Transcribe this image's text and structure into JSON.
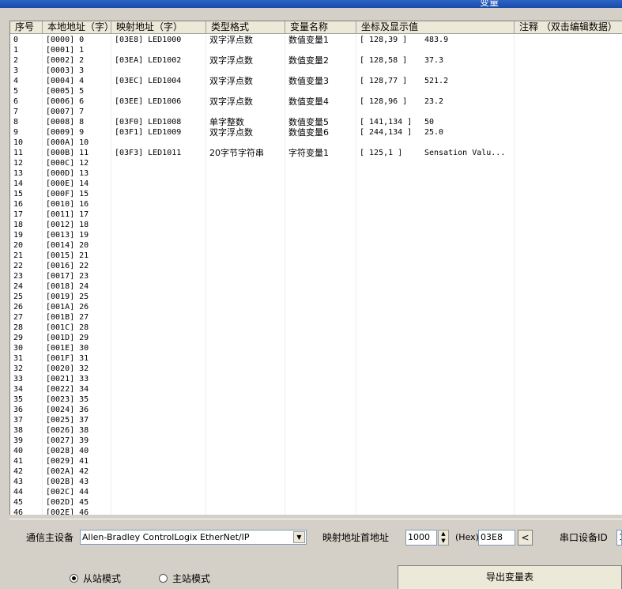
{
  "window": {
    "title": "变量"
  },
  "table": {
    "columns": [
      "序号",
      "本地地址（字）",
      "映射地址（字）",
      "类型格式",
      "变量名称",
      "坐标及显示值",
      "注释  （双击编辑数据）"
    ],
    "rows": [
      [
        "0",
        "[0000] 0",
        "[03E8] LED1000",
        "双字浮点数",
        "数值变量1",
        "[ 128,39  ]",
        "483.9",
        ""
      ],
      [
        "1",
        "[0001] 1",
        "",
        "",
        "",
        "",
        "",
        ""
      ],
      [
        "2",
        "[0002] 2",
        "[03EA] LED1002",
        "双字浮点数",
        "数值变量2",
        "[ 128,58  ]",
        "37.3",
        ""
      ],
      [
        "3",
        "[0003] 3",
        "",
        "",
        "",
        "",
        "",
        ""
      ],
      [
        "4",
        "[0004] 4",
        "[03EC] LED1004",
        "双字浮点数",
        "数值变量3",
        "[ 128,77  ]",
        "521.2",
        ""
      ],
      [
        "5",
        "[0005] 5",
        "",
        "",
        "",
        "",
        "",
        ""
      ],
      [
        "6",
        "[0006] 6",
        "[03EE] LED1006",
        "双字浮点数",
        "数值变量4",
        "[ 128,96  ]",
        "23.2",
        ""
      ],
      [
        "7",
        "[0007] 7",
        "",
        "",
        "",
        "",
        "",
        ""
      ],
      [
        "8",
        "[0008] 8",
        "[03F0] LED1008",
        "单字整数",
        "数值变量5",
        "[ 141,134 ]",
        "50",
        ""
      ],
      [
        "9",
        "[0009] 9",
        "[03F1] LED1009",
        "双字浮点数",
        "数值变量6",
        "[ 244,134 ]",
        "25.0",
        ""
      ],
      [
        "10",
        "[000A] 10",
        "",
        "",
        "",
        "",
        "",
        ""
      ],
      [
        "11",
        "[000B] 11",
        "[03F3] LED1011",
        "20字节字符串",
        "字符变量1",
        "[ 125,1   ]",
        "Sensation Valu...",
        ""
      ],
      [
        "12",
        "[000C] 12",
        "",
        "",
        "",
        "",
        "",
        ""
      ],
      [
        "13",
        "[000D] 13",
        "",
        "",
        "",
        "",
        "",
        ""
      ],
      [
        "14",
        "[000E] 14",
        "",
        "",
        "",
        "",
        "",
        ""
      ],
      [
        "15",
        "[000F] 15",
        "",
        "",
        "",
        "",
        "",
        ""
      ],
      [
        "16",
        "[0010] 16",
        "",
        "",
        "",
        "",
        "",
        ""
      ],
      [
        "17",
        "[0011] 17",
        "",
        "",
        "",
        "",
        "",
        ""
      ],
      [
        "18",
        "[0012] 18",
        "",
        "",
        "",
        "",
        "",
        ""
      ],
      [
        "19",
        "[0013] 19",
        "",
        "",
        "",
        "",
        "",
        ""
      ],
      [
        "20",
        "[0014] 20",
        "",
        "",
        "",
        "",
        "",
        ""
      ],
      [
        "21",
        "[0015] 21",
        "",
        "",
        "",
        "",
        "",
        ""
      ],
      [
        "22",
        "[0016] 22",
        "",
        "",
        "",
        "",
        "",
        ""
      ],
      [
        "23",
        "[0017] 23",
        "",
        "",
        "",
        "",
        "",
        ""
      ],
      [
        "24",
        "[0018] 24",
        "",
        "",
        "",
        "",
        "",
        ""
      ],
      [
        "25",
        "[0019] 25",
        "",
        "",
        "",
        "",
        "",
        ""
      ],
      [
        "26",
        "[001A] 26",
        "",
        "",
        "",
        "",
        "",
        ""
      ],
      [
        "27",
        "[001B] 27",
        "",
        "",
        "",
        "",
        "",
        ""
      ],
      [
        "28",
        "[001C] 28",
        "",
        "",
        "",
        "",
        "",
        ""
      ],
      [
        "29",
        "[001D] 29",
        "",
        "",
        "",
        "",
        "",
        ""
      ],
      [
        "30",
        "[001E] 30",
        "",
        "",
        "",
        "",
        "",
        ""
      ],
      [
        "31",
        "[001F] 31",
        "",
        "",
        "",
        "",
        "",
        ""
      ],
      [
        "32",
        "[0020] 32",
        "",
        "",
        "",
        "",
        "",
        ""
      ],
      [
        "33",
        "[0021] 33",
        "",
        "",
        "",
        "",
        "",
        ""
      ],
      [
        "34",
        "[0022] 34",
        "",
        "",
        "",
        "",
        "",
        ""
      ],
      [
        "35",
        "[0023] 35",
        "",
        "",
        "",
        "",
        "",
        ""
      ],
      [
        "36",
        "[0024] 36",
        "",
        "",
        "",
        "",
        "",
        ""
      ],
      [
        "37",
        "[0025] 37",
        "",
        "",
        "",
        "",
        "",
        ""
      ],
      [
        "38",
        "[0026] 38",
        "",
        "",
        "",
        "",
        "",
        ""
      ],
      [
        "39",
        "[0027] 39",
        "",
        "",
        "",
        "",
        "",
        ""
      ],
      [
        "40",
        "[0028] 40",
        "",
        "",
        "",
        "",
        "",
        ""
      ],
      [
        "41",
        "[0029] 41",
        "",
        "",
        "",
        "",
        "",
        ""
      ],
      [
        "42",
        "[002A] 42",
        "",
        "",
        "",
        "",
        "",
        ""
      ],
      [
        "43",
        "[002B] 43",
        "",
        "",
        "",
        "",
        "",
        ""
      ],
      [
        "44",
        "[002C] 44",
        "",
        "",
        "",
        "",
        "",
        ""
      ],
      [
        "45",
        "[002D] 45",
        "",
        "",
        "",
        "",
        "",
        ""
      ],
      [
        "46",
        "[002E] 46",
        "",
        "",
        "",
        "",
        "",
        ""
      ]
    ]
  },
  "bottom": {
    "master_device_label": "通信主设备",
    "master_device_value": "Allen-Bradley ControlLogix EtherNet/IP",
    "map_addr_label": "映射地址首地址",
    "map_addr_value": "1000",
    "hex_label": "(Hex)",
    "hex_value": "03E8",
    "arrow_button": "<",
    "serial_id_label": "串口设备ID",
    "serial_id_value": "1",
    "slave_mode": "从站模式",
    "master_mode": "主站模式",
    "export_button": "导出变量表"
  },
  "icons": {
    "dropdown": "chevron-down-icon",
    "spin_up": "spin-up-icon",
    "spin_down": "spin-down-icon"
  }
}
